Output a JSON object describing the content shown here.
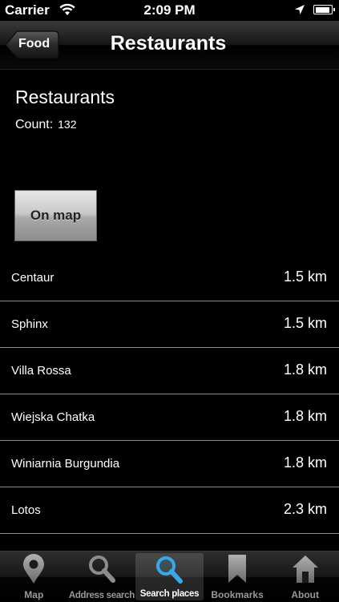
{
  "status_bar": {
    "carrier": "Carrier",
    "time": "2:09 PM",
    "icons": [
      "wifi-icon",
      "location-arrow-icon",
      "battery-icon"
    ]
  },
  "nav": {
    "back_label": "Food",
    "title": "Restaurants"
  },
  "header": {
    "title": "Restaurants",
    "count_label": "Count:",
    "count_value": "132"
  },
  "on_map_label": "On map",
  "restaurants": [
    {
      "name": "Centaur",
      "distance": "1.5 km"
    },
    {
      "name": "Sphinx",
      "distance": "1.5 km"
    },
    {
      "name": "Villa Rossa",
      "distance": "1.8 km"
    },
    {
      "name": "Wiejska Chatka",
      "distance": "1.8 km"
    },
    {
      "name": "Winiarnia Burgundia",
      "distance": "1.8 km"
    },
    {
      "name": "Lotos",
      "distance": "2.3 km"
    }
  ],
  "tabs": [
    {
      "label": "Map",
      "icon": "map-pin-icon",
      "active": false
    },
    {
      "label": "Address search",
      "icon": "magnifier-icon",
      "active": false
    },
    {
      "label": "Search places",
      "icon": "magnifier-blue-icon",
      "active": true
    },
    {
      "label": "Bookmarks",
      "icon": "bookmark-icon",
      "active": false
    },
    {
      "label": "About",
      "icon": "home-icon",
      "active": false
    }
  ],
  "colors": {
    "background": "#000000",
    "active_search_icon": "#3aa7e6",
    "inactive_icon": "#8c8c8c"
  }
}
